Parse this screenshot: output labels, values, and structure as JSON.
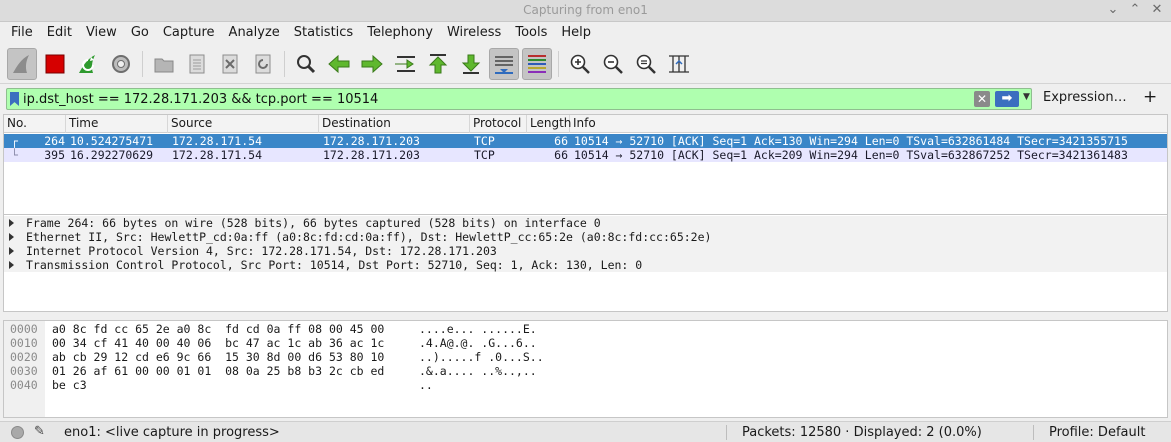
{
  "window": {
    "title": "Capturing from eno1",
    "controls": [
      "⌄",
      "⌃",
      "✕"
    ]
  },
  "menu": [
    "File",
    "Edit",
    "View",
    "Go",
    "Capture",
    "Analyze",
    "Statistics",
    "Telephony",
    "Wireless",
    "Tools",
    "Help"
  ],
  "toolbar": {
    "buttons": [
      "start-capture",
      "stop-capture",
      "restart-capture",
      "capture-options",
      "open-file",
      "save-file",
      "close-file",
      "reload-file",
      "find-packet",
      "go-back",
      "go-forward",
      "go-to-packet",
      "first-packet",
      "last-packet",
      "auto-scroll",
      "colorize",
      "zoom-in",
      "zoom-out",
      "normal-size",
      "resize-columns"
    ]
  },
  "filter": {
    "value": "ip.dst_host == 172.28.171.203 && tcp.port == 10514",
    "expression_label": "Expression…",
    "add_label": "+"
  },
  "packet_list": {
    "columns": [
      "No.",
      "Time",
      "Source",
      "Destination",
      "Protocol",
      "Length",
      "Info"
    ],
    "rows": [
      {
        "no": "264",
        "time": "10.524275471",
        "source": "172.28.171.54",
        "destination": "172.28.171.203",
        "protocol": "TCP",
        "length": "66",
        "info": "10514 → 52710 [ACK] Seq=1 Ack=130 Win=294 Len=0 TSval=632861484 TSecr=3421355715",
        "selected": true
      },
      {
        "no": "395",
        "time": "16.292270629",
        "source": "172.28.171.54",
        "destination": "172.28.171.203",
        "protocol": "TCP",
        "length": "66",
        "info": "10514 → 52710 [ACK] Seq=1 Ack=209 Win=294 Len=0 TSval=632867252 TSecr=3421361483",
        "selected": false
      }
    ]
  },
  "details": [
    "Frame 264: 66 bytes on wire (528 bits), 66 bytes captured (528 bits) on interface 0",
    "Ethernet II, Src: HewlettP_cd:0a:ff (a0:8c:fd:cd:0a:ff), Dst: HewlettP_cc:65:2e (a0:8c:fd:cc:65:2e)",
    "Internet Protocol Version 4, Src: 172.28.171.54, Dst: 172.28.171.203",
    "Transmission Control Protocol, Src Port: 10514, Dst Port: 52710, Seq: 1, Ack: 130, Len: 0"
  ],
  "bytes": [
    {
      "offset": "0000",
      "hex": "a0 8c fd cc 65 2e a0 8c  fd cd 0a ff 08 00 45 00",
      "ascii": "....e... ......E."
    },
    {
      "offset": "0010",
      "hex": "00 34 cf 41 40 00 40 06  bc 47 ac 1c ab 36 ac 1c",
      "ascii": ".4.A@.@. .G...6.."
    },
    {
      "offset": "0020",
      "hex": "ab cb 29 12 cd e6 9c 66  15 30 8d 00 d6 53 80 10",
      "ascii": "..).....f .0...S.."
    },
    {
      "offset": "0030",
      "hex": "01 26 af 61 00 00 01 01  08 0a 25 b8 b3 2c cb ed",
      "ascii": ".&.a.... ..%..,.."
    },
    {
      "offset": "0040",
      "hex": "be c3",
      "ascii": ".."
    }
  ],
  "status": {
    "capture_text": "eno1: <live capture in progress>",
    "packets_text": "Packets: 12580 · Displayed: 2 (0.0%)",
    "profile_text": "Profile: Default"
  }
}
